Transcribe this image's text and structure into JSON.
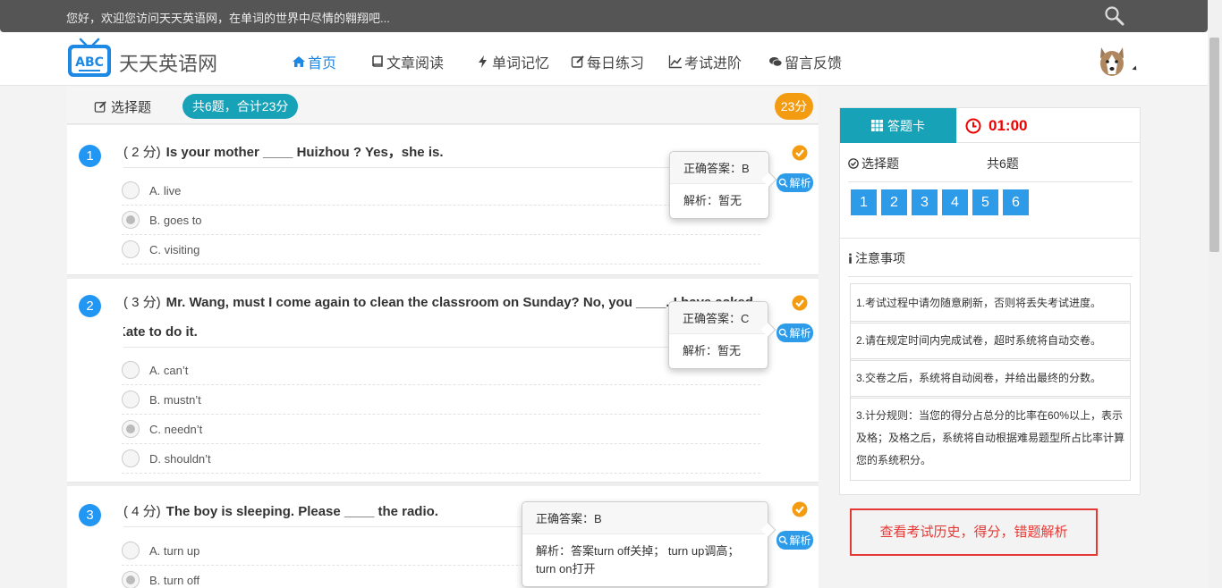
{
  "topbar": {
    "welcome": "您好，欢迎您访问天天英语网，在单词的世界中尽情的翱翔吧..."
  },
  "navbar": {
    "logo_text": "ABC",
    "brand": "天天英语网",
    "items": [
      {
        "label": "首页",
        "icon": "home-icon"
      },
      {
        "label": "文章阅读",
        "icon": "book-icon"
      },
      {
        "label": "单词记忆",
        "icon": "bolt-icon"
      },
      {
        "label": "每日练习",
        "icon": "edit-icon"
      },
      {
        "label": "考试进阶",
        "icon": "chart-icon"
      },
      {
        "label": "留言反馈",
        "icon": "comments-icon"
      }
    ]
  },
  "main": {
    "section_title": "选择题",
    "total": "共6题，合计23分",
    "score": "23分",
    "analyze_label": "解析",
    "questions": [
      {
        "num": "1",
        "points": "( 2 分)",
        "text": "Is your mother ____ Huizhou ? Yes，she is.",
        "options": [
          "A. live",
          "B. goes to",
          "C. visiting"
        ],
        "answer": "正确答案：B",
        "analysis": "解析：暂无"
      },
      {
        "num": "2",
        "points": "( 3 分)",
        "text": "Mr. Wang, must I come again to clean the classroom on Sunday? No, you ____. I have asked",
        "text2": "Kate to do it.",
        "options": [
          "A. can’t",
          "B. mustn’t",
          "C. needn’t",
          "D. shouldn’t"
        ],
        "answer": "正确答案：C",
        "analysis": "解析：暂无"
      },
      {
        "num": "3",
        "points": "( 4 分)",
        "text": "The boy is sleeping. Please ____ the radio.",
        "options": [
          "A. turn up",
          "B. turn off"
        ],
        "answer": "正确答案：B",
        "analysis": "解析：答案turn off关掉； turn up调高；turn on打开"
      }
    ]
  },
  "side": {
    "card_tab": "答题卡",
    "timer": "01:00",
    "section_label": "选择题",
    "count": "共6题",
    "numbers": [
      "1",
      "2",
      "3",
      "4",
      "5",
      "6"
    ],
    "notice_title": "注意事项",
    "notices": [
      "1.考试过程中请勿随意刷新，否则将丢失考试进度。",
      "2.请在规定时间内完成试卷，超时系统将自动交卷。",
      "3.交卷之后，系统将自动阅卷，并给出最终的分数。",
      "3.计分规则：当您的得分占总分的比率在60%以上，表示及格；及格之后，系统将自动根据难易题型所占比率计算您的系统积分。"
    ]
  },
  "history_button": "查看考试历史，得分，错题解析",
  "colors": {
    "accent": "#17a2b8",
    "primary": "#2196f3",
    "danger": "#e53935",
    "warning": "#f39c12"
  }
}
